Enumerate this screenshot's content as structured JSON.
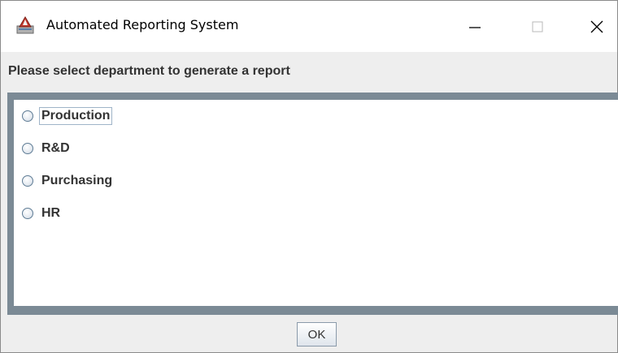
{
  "window": {
    "title": "Automated Reporting System",
    "icon": "java-app-icon",
    "controls": {
      "minimize": "minimize-icon",
      "maximize": "maximize-icon",
      "close": "close-icon"
    }
  },
  "prompt": {
    "text": "Please select department to generate a report"
  },
  "departments": {
    "options": [
      {
        "label": "Production",
        "selected": false,
        "focused": true
      },
      {
        "label": "R&D",
        "selected": false,
        "focused": false
      },
      {
        "label": "Purchasing",
        "selected": false,
        "focused": false
      },
      {
        "label": "HR",
        "selected": false,
        "focused": false
      }
    ]
  },
  "actions": {
    "ok_label": "OK"
  },
  "colors": {
    "panel_border": "#7b8a95",
    "text": "#333333",
    "radio_border": "#5f7c95"
  }
}
